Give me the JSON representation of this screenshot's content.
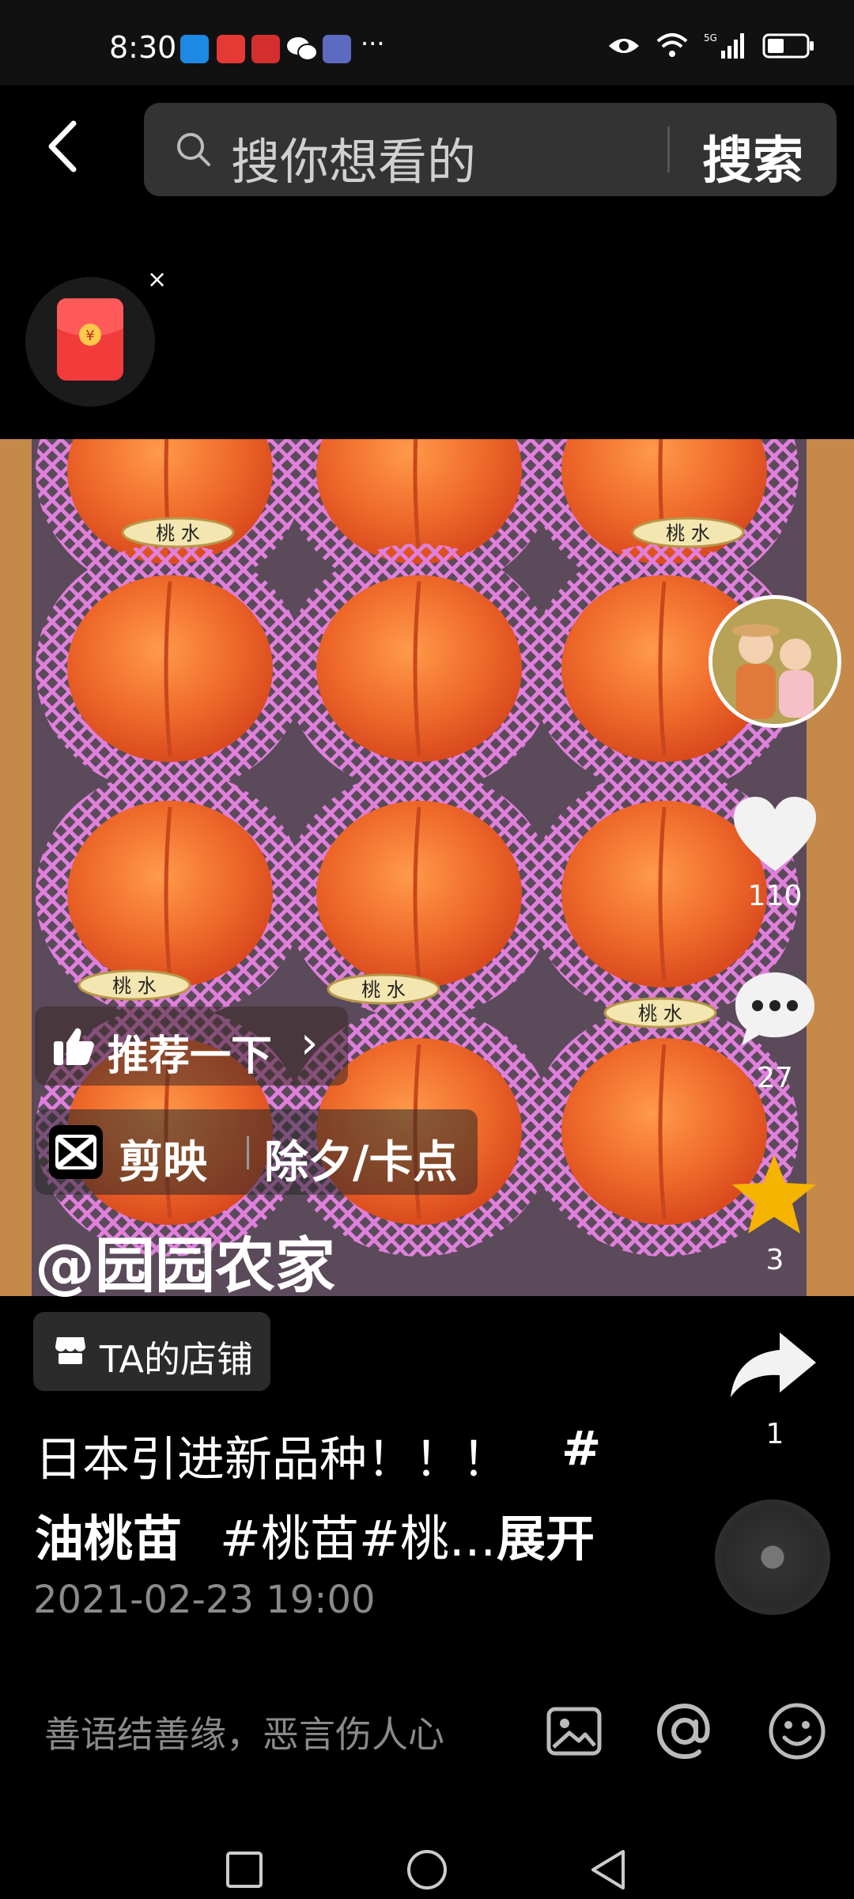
{
  "status_bar": {
    "time": "8:30",
    "more": "···"
  },
  "search": {
    "placeholder": "搜你想看的",
    "button": "搜索"
  },
  "red_packet": {
    "close": "×",
    "symbol": "¥"
  },
  "video": {
    "recommend_label": "推荐一下",
    "recommend_arrow": "›",
    "capcut_label": "剪映",
    "capcut_tag": "除夕/卡点",
    "author": "@园园农家",
    "label_text": "桃 水"
  },
  "actions": {
    "likes": "110",
    "comments": "27",
    "favorites": "3",
    "shares": "1"
  },
  "shop": {
    "label": "TA的店铺"
  },
  "description": {
    "line1": "日本引进新品种！！！",
    "line1_tag": "#",
    "line2_bold": "油桃苗",
    "line2_rest": " #桃苗#桃...",
    "expand": "展开"
  },
  "post_date": "2021-02-23 19:00",
  "comment": {
    "placeholder": "善语结善缘，恶言伤人心"
  },
  "colors": {
    "accent_star": "#f5b400",
    "red_packet": "#f23b3b",
    "peach": "#ef6a2a",
    "net": "#d86fd0"
  }
}
